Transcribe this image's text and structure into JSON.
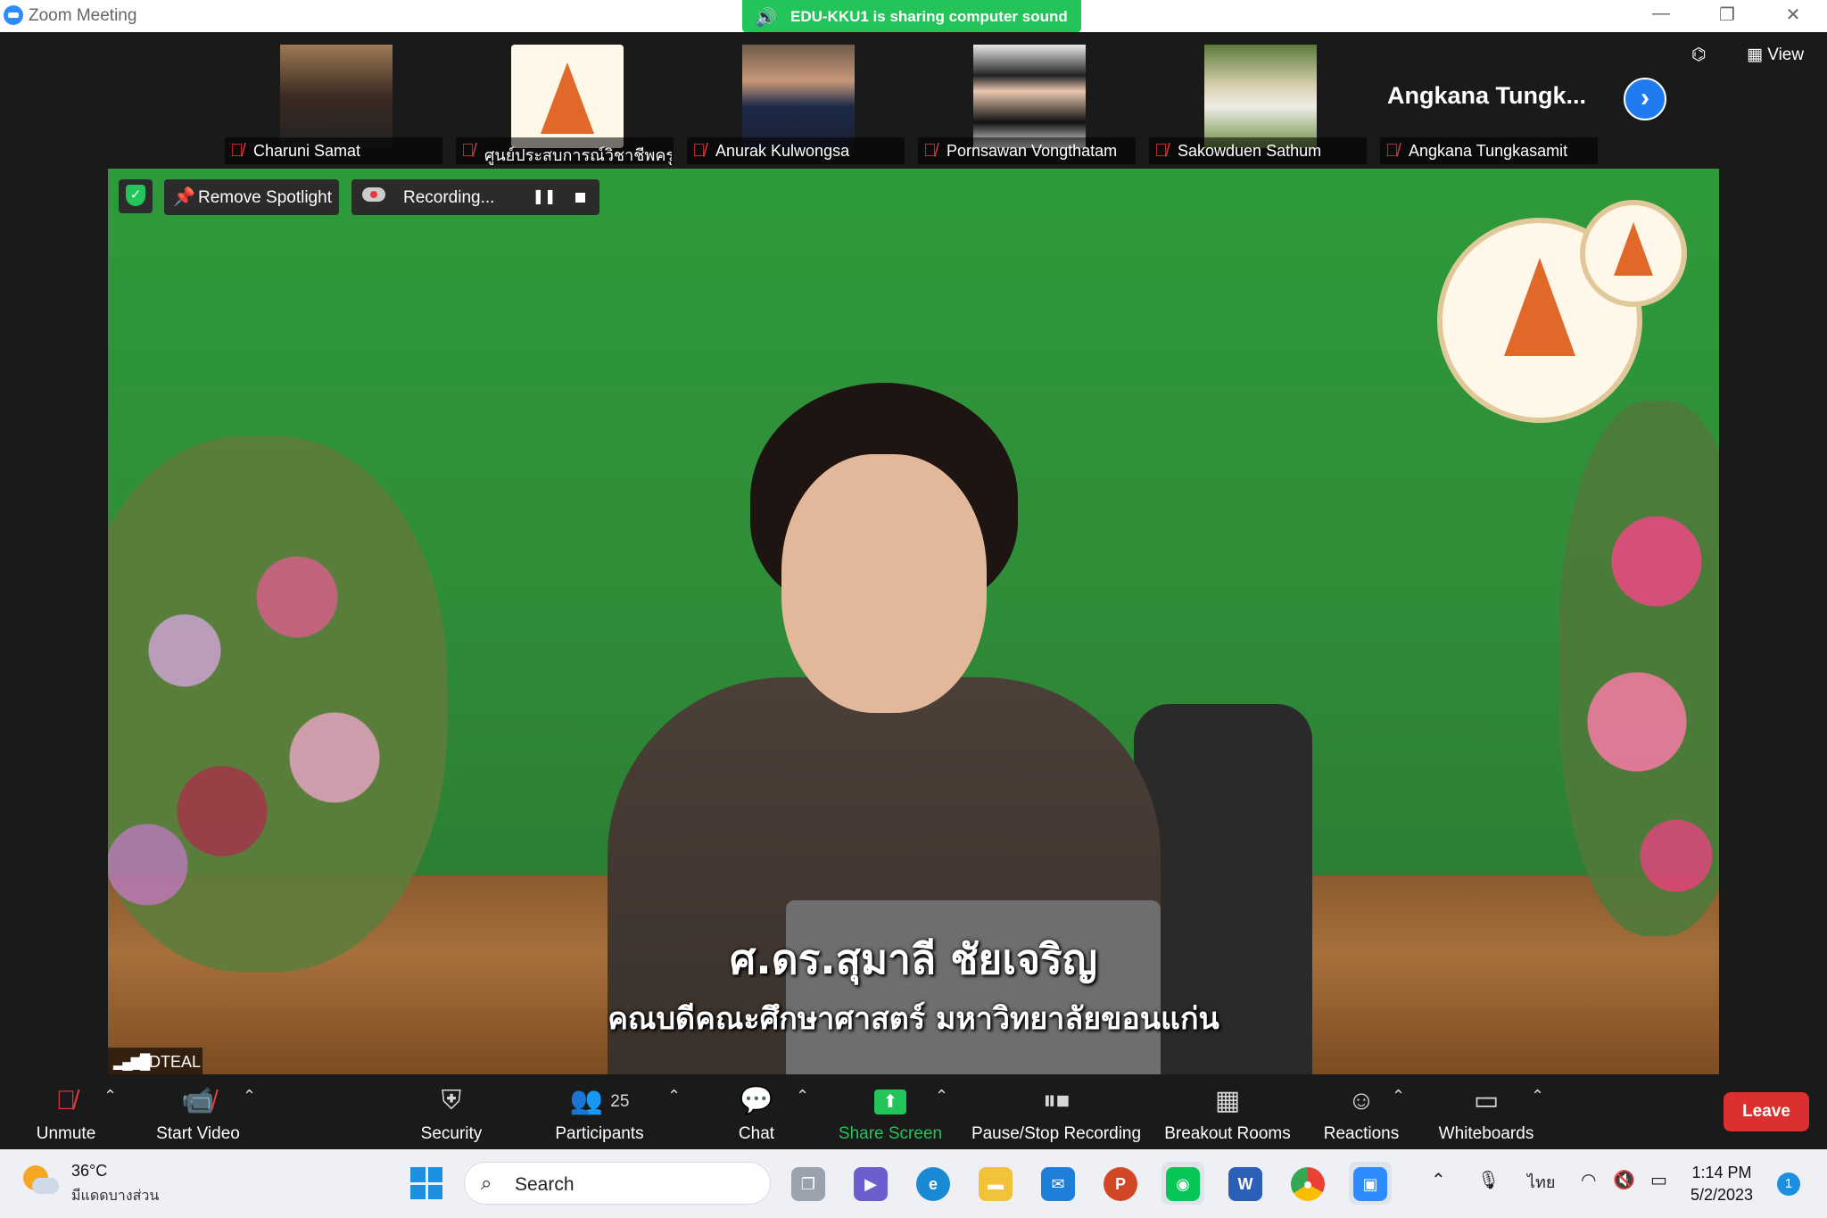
{
  "window": {
    "title": "Zoom Meeting",
    "sharing_banner": "EDU-KKU1 is sharing computer sound"
  },
  "top_tools": {
    "view_label": "View"
  },
  "participants_strip": [
    {
      "name": "Charuni Samat"
    },
    {
      "name": "ศูนย์ประสบการณ์วิชาชีพครู..."
    },
    {
      "name": "Anurak Kulwongsa"
    },
    {
      "name": "Pornsawan Vongthatam"
    },
    {
      "name": "Sakowduen Sathum"
    },
    {
      "name": "Angkana Tungkasamit",
      "display_large": "Angkana Tungk..."
    }
  ],
  "video_overlay": {
    "remove_spotlight": "Remove Spotlight",
    "recording": "Recording...",
    "speaker_label": "EDTEAL"
  },
  "captions": {
    "line1": "ศ.ดร.สุมาลี ชัยเจริญ",
    "line2": "คณบดีคณะศึกษาศาสตร์ มหาวิทยาลัยขอนแก่น"
  },
  "toolbar": {
    "unmute": "Unmute",
    "start_video": "Start Video",
    "security": "Security",
    "participants": "Participants",
    "participants_count": "25",
    "chat": "Chat",
    "share_screen": "Share Screen",
    "pause_stop_recording": "Pause/Stop Recording",
    "breakout_rooms": "Breakout Rooms",
    "reactions": "Reactions",
    "whiteboards": "Whiteboards",
    "leave": "Leave"
  },
  "taskbar": {
    "temperature": "36°C",
    "weather_desc": "มีแดดบางส่วน",
    "search_label": "Search",
    "language": "ไทย",
    "time": "1:14 PM",
    "date": "5/2/2023",
    "notification_count": "1",
    "apps": [
      "task-view",
      "teams",
      "edge",
      "file-explorer",
      "mail",
      "powerpoint",
      "line",
      "word",
      "chrome",
      "zoom"
    ]
  },
  "colors": {
    "share_green": "#23c45a",
    "muted_red": "#e8383b",
    "leave_red": "#dc2f2f",
    "zoom_blue": "#2d8cff",
    "video_bg_green": "#2f8f3a"
  }
}
